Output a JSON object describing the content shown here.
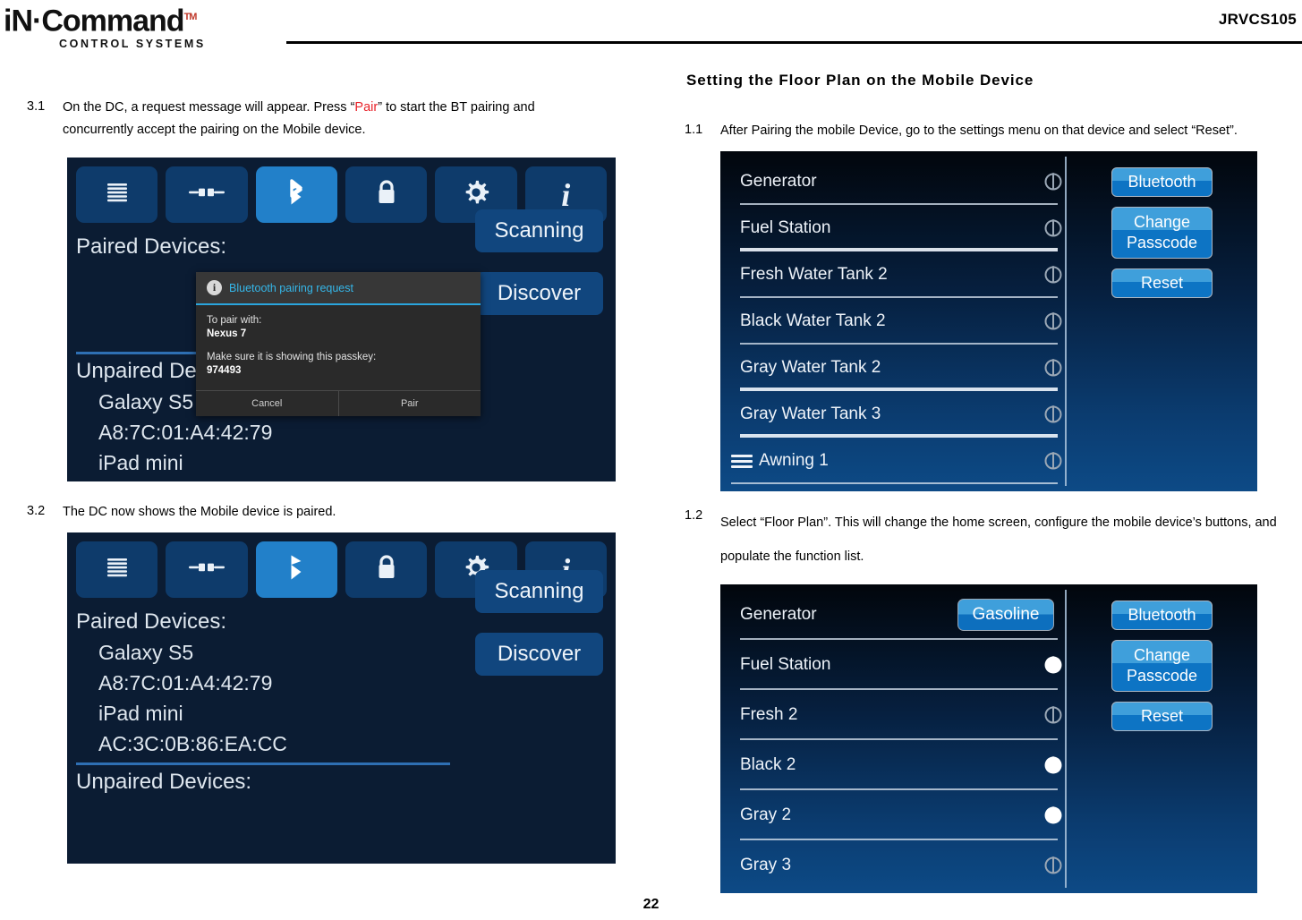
{
  "header": {
    "logo_main": "iN·Command",
    "logo_tm": "TM",
    "logo_sub": "CONTROL SYSTEMS",
    "doc_code": "JRVCS105"
  },
  "page_number": "22",
  "left_column": {
    "steps": [
      {
        "num": "3.1",
        "text_before": "On the DC, a request message will appear. Press “",
        "highlight": "Pair",
        "text_after": "” to start the BT pairing and concurrently accept the pairing on the Mobile device."
      },
      {
        "num": "3.2",
        "text": "The DC now shows the Mobile device is paired."
      }
    ],
    "bt_screen_1": {
      "icons": [
        "menu-icon",
        "link-icon",
        "bluetooth-icon",
        "lock-icon",
        "gear-icon",
        "info-icon"
      ],
      "active_icon_index": 2,
      "paired_label": "Paired Devices:",
      "paired_items": [],
      "unpaired_label": "Unpaired De",
      "unpaired_items": [
        "Galaxy S5",
        "A8:7C:01:A4:42:79",
        "iPad mini"
      ],
      "actions": [
        "Scanning",
        "Discover"
      ],
      "dialog": {
        "title": "Bluetooth pairing request",
        "line1": "To pair with:",
        "device": "Nexus 7",
        "line2": "Make sure it is showing this passkey:",
        "passkey": "974493",
        "cancel": "Cancel",
        "pair": "Pair"
      }
    },
    "bt_screen_2": {
      "icons": [
        "menu-icon",
        "link-icon",
        "bluetooth-icon",
        "lock-icon",
        "gear-icon",
        "info-icon"
      ],
      "active_icon_index": 2,
      "paired_label": "Paired Devices:",
      "paired_items": [
        "Galaxy S5",
        "A8:7C:01:A4:42:79",
        "iPad mini",
        "AC:3C:0B:86:EA:CC"
      ],
      "unpaired_label": "Unpaired Devices:",
      "unpaired_items": [],
      "actions": [
        "Scanning",
        "Discover"
      ]
    }
  },
  "right_column": {
    "section_title": "Setting the Floor Plan on the Mobile Device",
    "steps": [
      {
        "num": "1.1",
        "text": "After Pairing the mobile Device, go to the settings menu on that device and select “Reset”."
      },
      {
        "num": "1.2",
        "text": "Select “Floor Plan”. This will change the home screen, configure the mobile device’s buttons, and populate the function list."
      }
    ],
    "settings_screen_1": {
      "rows": [
        {
          "name": "Generator",
          "control": "toggle",
          "state": "off",
          "icon": null,
          "thick_sep": false
        },
        {
          "name": "Fuel Station",
          "control": "toggle",
          "state": "off",
          "icon": null,
          "thick_sep": true
        },
        {
          "name": "Fresh Water Tank 2",
          "control": "toggle",
          "state": "off",
          "icon": null,
          "thick_sep": false
        },
        {
          "name": "Black Water Tank 2",
          "control": "toggle",
          "state": "off",
          "icon": null,
          "thick_sep": false
        },
        {
          "name": "Gray Water Tank 2",
          "control": "toggle",
          "state": "off",
          "icon": null,
          "thick_sep": true
        },
        {
          "name": "Gray Water Tank 3",
          "control": "toggle",
          "state": "off",
          "icon": null,
          "thick_sep": true
        },
        {
          "name": "Awning 1",
          "control": "toggle",
          "state": "off",
          "icon": "menu-icon",
          "thick_sep": false
        }
      ],
      "side_buttons": [
        "Bluetooth",
        "Change\nPasscode",
        "Reset"
      ]
    },
    "settings_screen_2": {
      "rows": [
        {
          "name": "Generator",
          "control": "value",
          "value": "Gasoline",
          "state": "on",
          "icon": null,
          "thick_sep": false
        },
        {
          "name": "Fuel Station",
          "control": "toggle",
          "state": "on",
          "icon": null,
          "thick_sep": false
        },
        {
          "name": "Fresh 2",
          "control": "toggle",
          "state": "off",
          "icon": null,
          "thick_sep": false
        },
        {
          "name": "Black 2",
          "control": "toggle",
          "state": "on",
          "icon": null,
          "thick_sep": false
        },
        {
          "name": "Gray 2",
          "control": "toggle",
          "state": "on",
          "icon": null,
          "thick_sep": false
        },
        {
          "name": "Gray 3",
          "control": "toggle",
          "state": "off",
          "icon": null,
          "thick_sep": false
        }
      ],
      "side_buttons": [
        "Bluetooth",
        "Change\nPasscode",
        "Reset"
      ]
    }
  },
  "colors": {
    "accent_red": "#e8232a",
    "bt_panel_bg": "#0b1c33",
    "bt_button": "#0e3b6b",
    "bt_button_active": "#2280c9",
    "toggle_on": "#0d6fbe",
    "toggle_off": "#000000",
    "dialog_bg": "#2a2a2a",
    "dialog_accent": "#35b6e8"
  }
}
